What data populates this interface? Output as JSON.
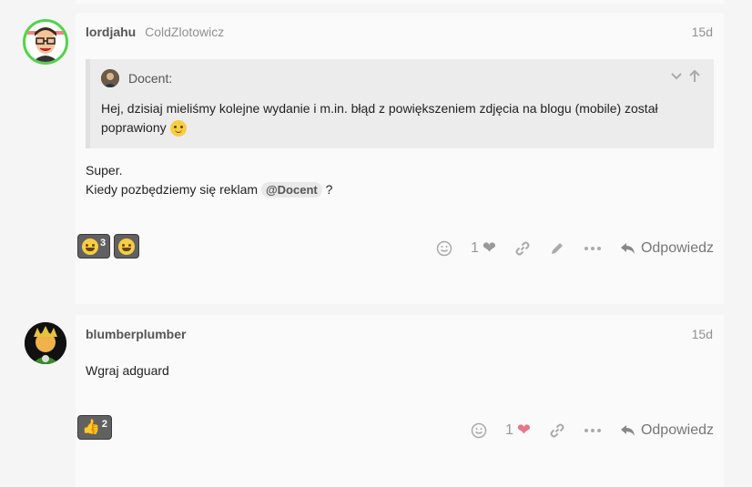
{
  "posts": [
    {
      "username": "lordjahu",
      "full_name": "ColdZlotowicz",
      "date": "15d",
      "quote": {
        "author": "Docent:",
        "text": "Hej, dzisiaj mieliśmy kolejne wydanie i m.in. błąd z powiększeniem zdjęcia na blogu (mobile) został poprawiony"
      },
      "body_line1": "Super.",
      "body_line2_before": "Kiedy pozbędziemy się reklam",
      "mention": "@Docent",
      "body_line2_after": "?",
      "reactions": [
        {
          "icon": "laughing-emoji-icon",
          "count": "3"
        },
        {
          "icon": "star-struck-emoji-icon",
          "count": ""
        }
      ],
      "like_count": "1",
      "reply_label": "Odpowiedz"
    },
    {
      "username": "blumberplumber",
      "date": "15d",
      "body": "Wgraj adguard",
      "reactions": [
        {
          "icon": "thumbs-up-emoji-icon",
          "count": "2"
        }
      ],
      "like_count": "1",
      "liked": true,
      "reply_label": "Odpowiedz"
    }
  ],
  "colors": {
    "avatar_ring": "#53d34a",
    "liked_heart": "#e8768a",
    "reaction_bg": "#616161"
  }
}
